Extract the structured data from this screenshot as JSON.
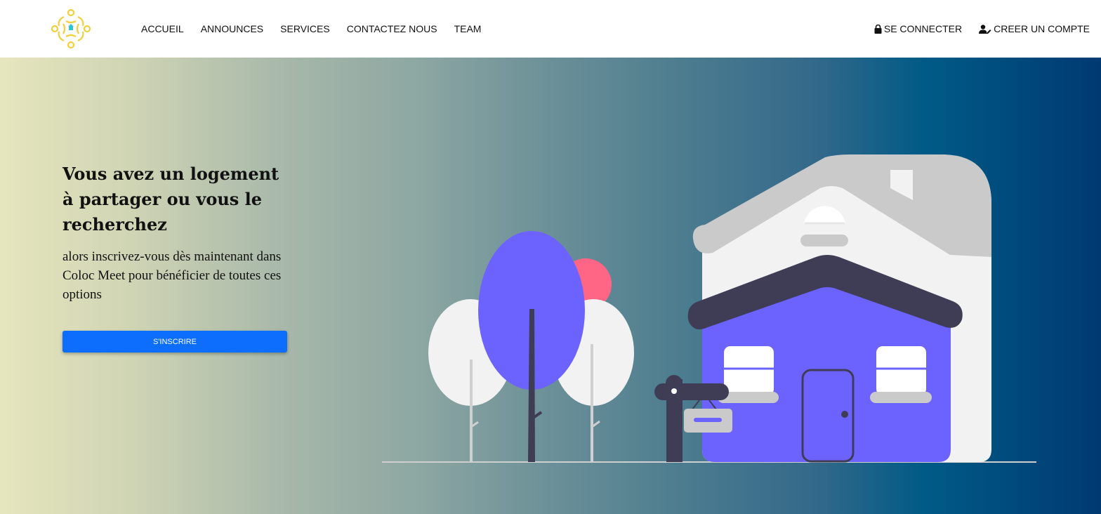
{
  "nav": {
    "links": [
      "ACCUEIL",
      "ANNOUNCES",
      "SERVICES",
      "CONTACTEZ NOUS",
      "TEAM"
    ],
    "login_label": "SE CONNECTER",
    "register_label": "CREER UN COMPTE",
    "login_icon": "lock-icon",
    "register_icon": "user-edit-icon"
  },
  "hero": {
    "title": "Vous avez un logement à partager ou vous le recherchez",
    "subtitle": "alors inscrivez-vous dès maintenant dans Coloc Meet pour bénéficier de toutes ces options",
    "cta_label": "S'INSCRIRE"
  },
  "colors": {
    "accent": "#0d6efd",
    "house": "#6c63ff",
    "roof_dark": "#3f3d56",
    "sun": "#ff6584"
  }
}
